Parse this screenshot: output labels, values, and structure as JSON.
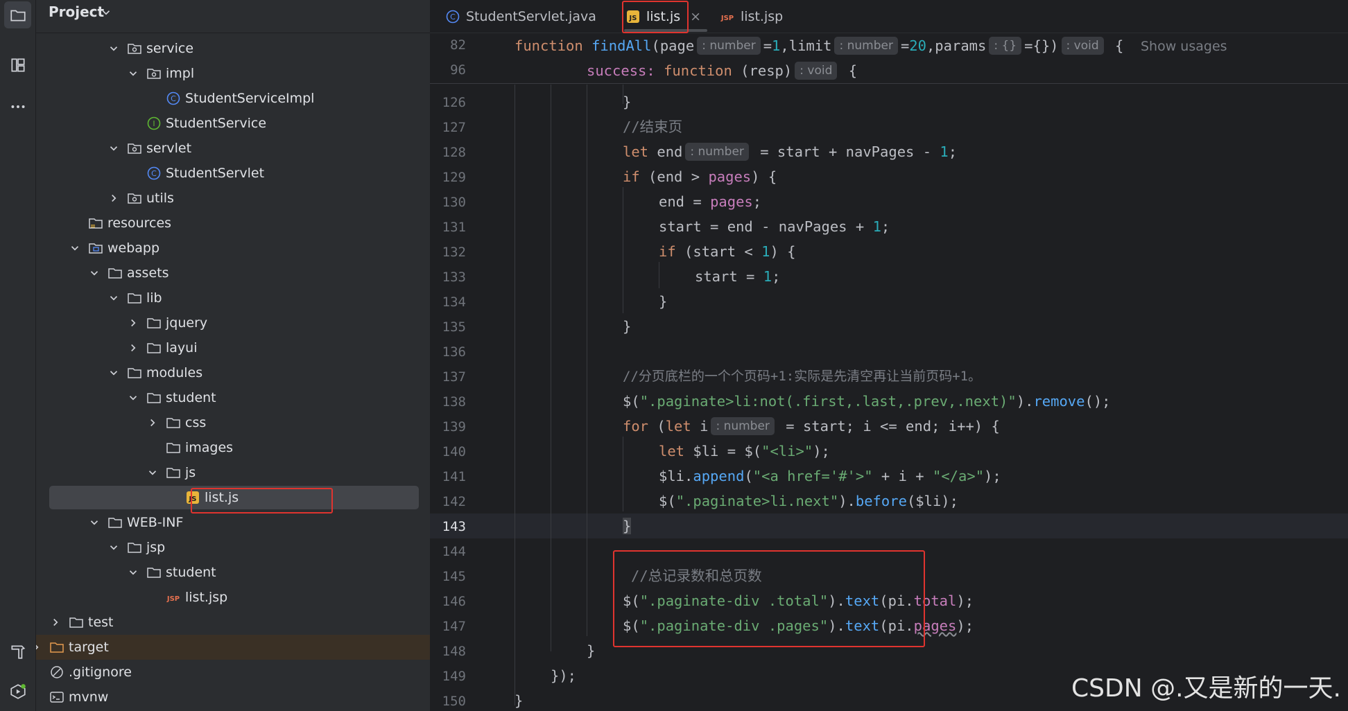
{
  "sidebar_strip": {
    "icons": [
      "folder-icon",
      "structure-icon",
      "more-icon",
      "build-icon",
      "services-icon"
    ]
  },
  "project": {
    "title": "Project",
    "tree": [
      {
        "label": "service",
        "type": "package",
        "depth": 7,
        "expanded": true
      },
      {
        "label": "impl",
        "type": "package",
        "depth": 8,
        "expanded": true
      },
      {
        "label": "StudentServiceImpl",
        "type": "class",
        "depth": 9
      },
      {
        "label": "StudentService",
        "type": "interface",
        "depth": 8
      },
      {
        "label": "servlet",
        "type": "package",
        "depth": 7,
        "expanded": true
      },
      {
        "label": "StudentServlet",
        "type": "class",
        "depth": 8
      },
      {
        "label": "utils",
        "type": "package",
        "depth": 7,
        "expanded": false
      },
      {
        "label": "resources",
        "type": "resources",
        "depth": 5
      },
      {
        "label": "webapp",
        "type": "webfolder",
        "depth": 5,
        "expanded": true
      },
      {
        "label": "assets",
        "type": "folder",
        "depth": 6,
        "expanded": true
      },
      {
        "label": "lib",
        "type": "folder",
        "depth": 7,
        "expanded": true
      },
      {
        "label": "jquery",
        "type": "folder",
        "depth": 8,
        "expanded": false
      },
      {
        "label": "layui",
        "type": "folder",
        "depth": 8,
        "expanded": false
      },
      {
        "label": "modules",
        "type": "folder",
        "depth": 7,
        "expanded": true
      },
      {
        "label": "student",
        "type": "folder",
        "depth": 8,
        "expanded": true
      },
      {
        "label": "css",
        "type": "folder",
        "depth": 9,
        "expanded": false
      },
      {
        "label": "images",
        "type": "folder",
        "depth": 9
      },
      {
        "label": "js",
        "type": "folder",
        "depth": 9,
        "expanded": true
      },
      {
        "label": "list.js",
        "type": "js",
        "depth": 10,
        "selected": true
      },
      {
        "label": "WEB-INF",
        "type": "folder",
        "depth": 6,
        "expanded": true
      },
      {
        "label": "jsp",
        "type": "folder",
        "depth": 7,
        "expanded": true
      },
      {
        "label": "student",
        "type": "folder",
        "depth": 8,
        "expanded": true
      },
      {
        "label": "list.jsp",
        "type": "jsp",
        "depth": 9
      },
      {
        "label": "test",
        "type": "folder",
        "depth": 4,
        "expanded": false
      },
      {
        "label": "target",
        "type": "folder-orange",
        "depth": 3,
        "expanded": false
      },
      {
        "label": ".gitignore",
        "type": "ignore",
        "depth": 3
      },
      {
        "label": "mvnw",
        "type": "script",
        "depth": 3
      }
    ]
  },
  "tabs": [
    {
      "label": "StudentServlet.java",
      "icon": "class-icon"
    },
    {
      "label": "list.js",
      "icon": "js-file-icon",
      "active": true,
      "close": "×"
    },
    {
      "label": "list.jsp",
      "icon": "jsp-file-icon"
    }
  ],
  "sticky_lines": [
    {
      "num": "82",
      "hint_show_usages": "Show usages"
    },
    {
      "num": "96"
    }
  ],
  "hints": {
    "number": ": number",
    "obj": ": {}",
    "void": ": void",
    "show_usages": "Show usages"
  },
  "lines": {
    "l126": "126",
    "l127": "127",
    "l128": "128",
    "l129": "129",
    "l130": "130",
    "l131": "131",
    "l132": "132",
    "l133": "133",
    "l134": "134",
    "l135": "135",
    "l136": "136",
    "l137": "137",
    "l138": "138",
    "l139": "139",
    "l140": "140",
    "l141": "141",
    "l142": "142",
    "l143": "143",
    "l144": "144",
    "l145": "145",
    "l146": "146",
    "l147": "147",
    "l148": "148",
    "l149": "149",
    "l150": "150"
  },
  "code_text": {
    "c82_fn": "function",
    "c82_name": "findAll",
    "c82_page": "(page",
    "c82_eq1": "=",
    "c82_one": "1",
    "c82_limit": ",limit",
    "c82_eq2": "=",
    "c82_twenty": "20",
    "c82_params": ",params",
    "c82_eq3": "={})",
    "c82_brace": " {",
    "c96_success": "success: ",
    "c96_fn": "function",
    "c96_resp": " (resp)",
    "c96_brace": " {",
    "c126": "}",
    "c127": "//结束页",
    "c128_let": "let",
    "c128_end": " end",
    "c128_rest": " = start + navPages - ",
    "c128_one": "1",
    "c128_semi": ";",
    "c129_if": "if",
    "c129_a": " (end > ",
    "c129_pages": "pages",
    "c129_b": ") {",
    "c130_a": "end = ",
    "c130_pages": "pages",
    "c130_b": ";",
    "c131_a": "start = end - navPages + ",
    "c131_one": "1",
    "c131_b": ";",
    "c132_if": "if",
    "c132_a": " (start < ",
    "c132_one": "1",
    "c132_b": ") {",
    "c133_a": "start = ",
    "c133_one": "1",
    "c133_b": ";",
    "c134": "}",
    "c135": "}",
    "c137": "//分页底栏的一个个页码+1:实际是先清空再让当前页码+1。",
    "c138_d": "$(",
    "c138_s": "\".paginate>li:not(.first,.last,.prev,.next)\"",
    "c138_c": ").",
    "c138_fn": "remove",
    "c138_e": "();",
    "c139_for": "for",
    "c139_a": " (",
    "c139_let": "let",
    "c139_i": " i",
    "c139_b": " = start; i <= end; i++) {",
    "c140_let": "let",
    "c140_a": " $li = ",
    "c140_d": "$(",
    "c140_s": "\"<li>\"",
    "c140_e": ");",
    "c141_a": "$li.",
    "c141_fn": "append",
    "c141_b": "(",
    "c141_s1": "\"<a href='#'>\"",
    "c141_c": " + i + ",
    "c141_s2": "\"</a>\"",
    "c141_e": ");",
    "c142_d": "$(",
    "c142_s": "\".paginate>li.next\"",
    "c142_c": ").",
    "c142_fn": "before",
    "c142_e": "($li);",
    "c143": "}",
    "c145": "//总记录数和总页数",
    "c146_d": "$(",
    "c146_s": "\".paginate-div .total\"",
    "c146_c": ").",
    "c146_fn": "text",
    "c146_a": "(pi.",
    "c146_p": "total",
    "c146_e": ");",
    "c147_d": "$(",
    "c147_s": "\".paginate-div .pages\"",
    "c147_c": ").",
    "c147_fn": "text",
    "c147_a": "(pi.",
    "c147_p": "pages",
    "c147_e": ");",
    "c148": "}",
    "c149": "});",
    "c150": "}"
  },
  "watermark": "CSDN @.又是新的一天.",
  "colors": {
    "keyword": "#cf8e6d",
    "function": "#56a8f5",
    "number": "#2aacb8",
    "string": "#6aab73",
    "comment": "#7a7e85",
    "property": "#c77dbb",
    "highlight": "#e0342f"
  }
}
